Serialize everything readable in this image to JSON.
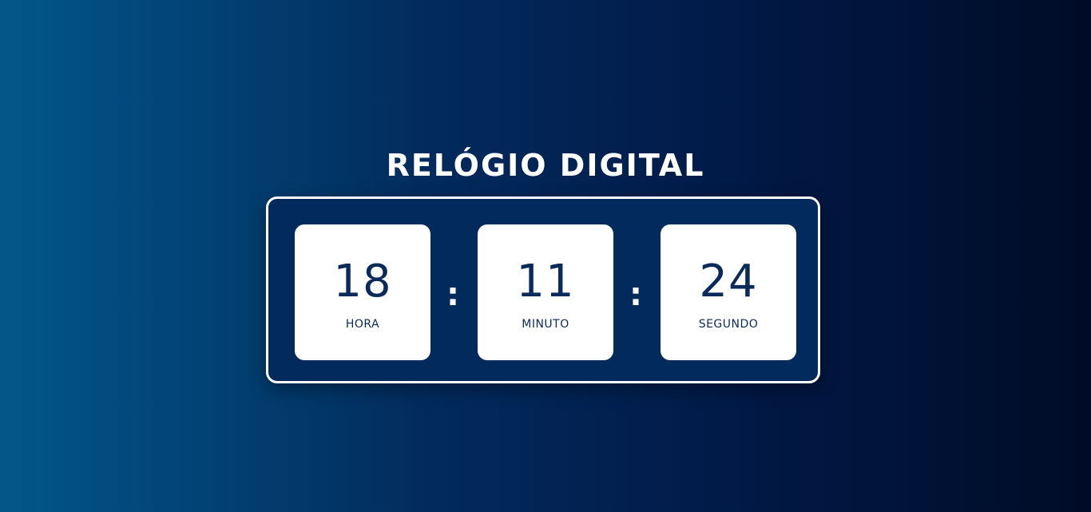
{
  "title": "RELÓGIO DIGITAL",
  "clock": {
    "separator": ":",
    "hour": {
      "value": "18",
      "label": "HORA"
    },
    "minute": {
      "value": "11",
      "label": "MINUTO"
    },
    "second": {
      "value": "24",
      "label": "SEGUNDO"
    }
  },
  "colors": {
    "background_start": "#02578a",
    "background_end": "#000c26",
    "frame": "#022a5c",
    "digit": "#0b2a5c",
    "text_on_dark": "#ffffff"
  }
}
